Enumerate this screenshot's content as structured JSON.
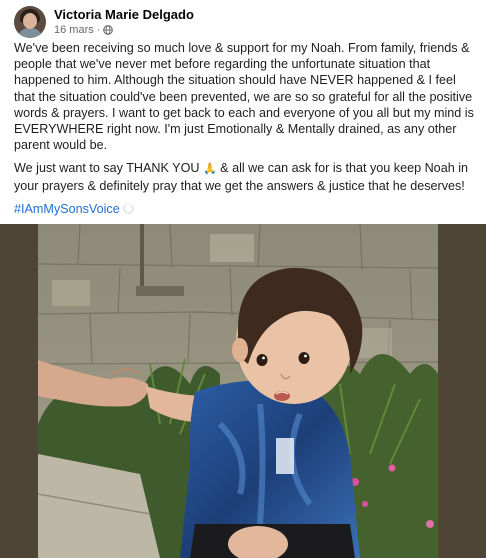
{
  "post": {
    "author": "Victoria Marie Delgado",
    "date": "16 mars",
    "separator": "·",
    "privacy_icon": "globe-icon",
    "paragraph_1": "We've been receiving so much love & support for my Noah. From family, friends & people that we've never met before regarding the unfortunate situation that happened to him. Although the situation should have NEVER happened & I feel that the situation could've been prevented, we are so so grateful for all the positive words & prayers. I want to get back to each and everyone of you all but my mind is EVERYWHERE right now. I'm just Emotionally & Mentally drained, as any other parent would be.",
    "paragraph_2_before": "We just want to say THANK YOU ",
    "paragraph_2_emoji": "🙏",
    "paragraph_2_after": " & all we can ask for is that you keep Noah in your prayers & definitely pray that we get the answers & justice that he deserves!",
    "hashtag": "#IAmMySonsVoice"
  },
  "colors": {
    "hashtag": "#216fdb",
    "secondary_text": "#65676b",
    "media_border": "#4e4536"
  }
}
